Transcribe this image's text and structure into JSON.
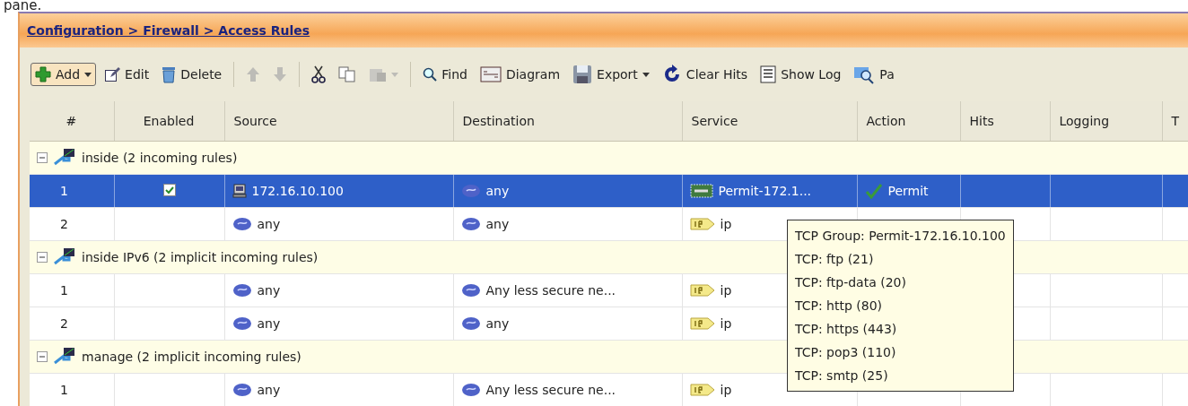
{
  "caption": "pane.",
  "breadcrumb": "Configuration > Firewall > Access Rules",
  "toolbar": [
    {
      "kind": "add",
      "label": "Add",
      "dropdown": true,
      "highlighted": true,
      "disabled": false
    },
    {
      "kind": "edit",
      "label": "Edit",
      "dropdown": false,
      "highlighted": false,
      "disabled": false
    },
    {
      "kind": "delete",
      "label": "Delete",
      "dropdown": false,
      "highlighted": false,
      "disabled": false
    },
    {
      "kind": "separator"
    },
    {
      "kind": "up",
      "dropdown": false,
      "highlighted": false,
      "disabled": true
    },
    {
      "kind": "down",
      "dropdown": false,
      "highlighted": false,
      "disabled": true
    },
    {
      "kind": "separator"
    },
    {
      "kind": "cut",
      "dropdown": false,
      "highlighted": false,
      "disabled": false
    },
    {
      "kind": "copy",
      "dropdown": false,
      "highlighted": false,
      "disabled": false
    },
    {
      "kind": "paste",
      "dropdown": true,
      "highlighted": false,
      "disabled": true
    },
    {
      "kind": "separator"
    },
    {
      "kind": "find",
      "label": "Find",
      "dropdown": false,
      "highlighted": false,
      "disabled": false
    },
    {
      "kind": "diagram",
      "label": "Diagram",
      "dropdown": false,
      "highlighted": false,
      "disabled": false
    },
    {
      "kind": "export",
      "label": "Export",
      "dropdown": true,
      "highlighted": false,
      "disabled": false
    },
    {
      "kind": "clear",
      "label": "Clear Hits",
      "dropdown": false,
      "highlighted": false,
      "disabled": false
    },
    {
      "kind": "log",
      "label": "Show Log",
      "dropdown": false,
      "highlighted": false,
      "disabled": false
    },
    {
      "kind": "packet",
      "label": "Pa",
      "dropdown": false,
      "highlighted": false,
      "disabled": false
    }
  ],
  "columns": [
    "#",
    "Enabled",
    "Source",
    "Destination",
    "Service",
    "Action",
    "Hits",
    "Logging",
    "T"
  ],
  "groups": [
    {
      "label": "inside (2 incoming rules)",
      "expanded": true,
      "rules": [
        {
          "number": "1",
          "enabled": true,
          "selected": true,
          "source": {
            "kind": "host",
            "text": "172.16.10.100"
          },
          "destination": {
            "kind": "network",
            "text": "any"
          },
          "service": {
            "kind": "tcp-group",
            "text": "Permit-172.1..."
          },
          "action": {
            "kind": "permit",
            "text": "Permit"
          }
        },
        {
          "number": "2",
          "enabled": false,
          "selected": false,
          "source": {
            "kind": "network",
            "text": "any"
          },
          "destination": {
            "kind": "network",
            "text": "any"
          },
          "service": {
            "kind": "ip",
            "text": "ip"
          }
        }
      ]
    },
    {
      "label": "inside IPv6 (2 implicit incoming rules)",
      "expanded": true,
      "rules": [
        {
          "number": "1",
          "enabled": false,
          "selected": false,
          "source": {
            "kind": "network",
            "text": "any"
          },
          "destination": {
            "kind": "network",
            "text": "Any less secure ne..."
          },
          "service": {
            "kind": "ip",
            "text": "ip"
          }
        },
        {
          "number": "2",
          "enabled": false,
          "selected": false,
          "source": {
            "kind": "network",
            "text": "any"
          },
          "destination": {
            "kind": "network",
            "text": "any"
          },
          "service": {
            "kind": "ip",
            "text": "ip"
          }
        }
      ]
    },
    {
      "label": "manage (2 implicit incoming rules)",
      "expanded": true,
      "rules": [
        {
          "number": "1",
          "enabled": false,
          "selected": false,
          "source": {
            "kind": "network",
            "text": "any"
          },
          "destination": {
            "kind": "network",
            "text": "Any less secure ne..."
          },
          "service": {
            "kind": "ip",
            "text": "ip"
          }
        }
      ]
    }
  ],
  "tooltip": [
    "TCP Group: Permit-172.16.10.100",
    "TCP: ftp (21)",
    "TCP: ftp-data (20)",
    "TCP: http (80)",
    "TCP: https (443)",
    "TCP: pop3 (110)",
    "TCP: smtp (25)"
  ]
}
